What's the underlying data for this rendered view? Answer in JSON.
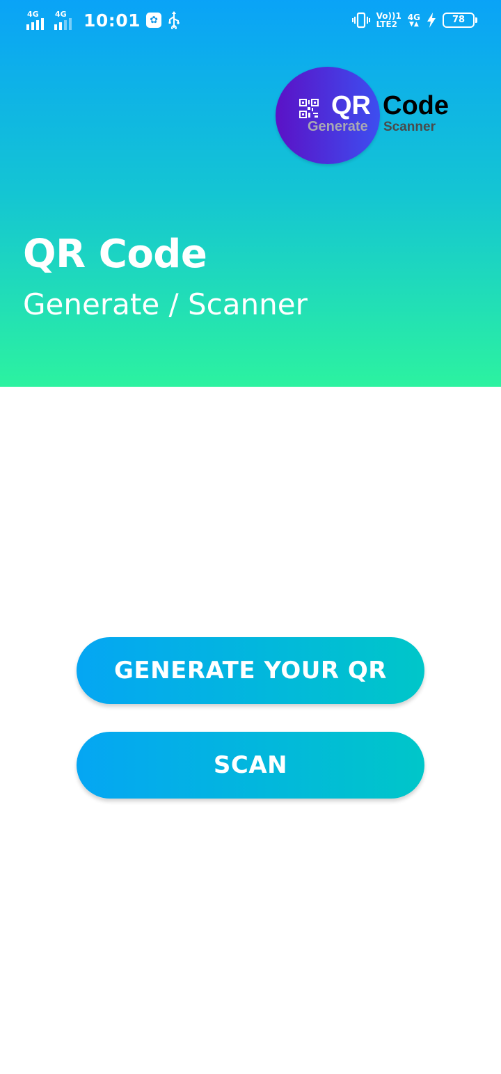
{
  "status_bar": {
    "sim1_network": "4G",
    "sim2_network": "4G",
    "time": "10:01",
    "volte_line1": "Vo))1",
    "volte_line2": "LTE2",
    "data_network": "4G",
    "battery_level": "78"
  },
  "logo": {
    "qr": "QR",
    "code": "Code",
    "generate": "Generate",
    "scanner": "Scanner"
  },
  "hero": {
    "title": "QR Code",
    "subtitle": "Generate / Scanner"
  },
  "actions": {
    "generate_label": "GENERATE YOUR QR",
    "scan_label": "SCAN"
  },
  "colors": {
    "hero_gradient_top": "#0aa3f7",
    "hero_gradient_bottom": "#2cf2a0",
    "button_gradient_start": "#05a6f3",
    "button_gradient_end": "#00c6c9",
    "logo_circle_start": "#5b12c6",
    "logo_circle_end": "#3d4ef0"
  },
  "icons": {
    "status_left": [
      "signal-icon",
      "signal-icon",
      "app-notification-icon",
      "usb-icon"
    ],
    "status_right": [
      "vibrate-icon",
      "charging-icon",
      "battery-icon"
    ],
    "logo": "qr-code-icon"
  }
}
